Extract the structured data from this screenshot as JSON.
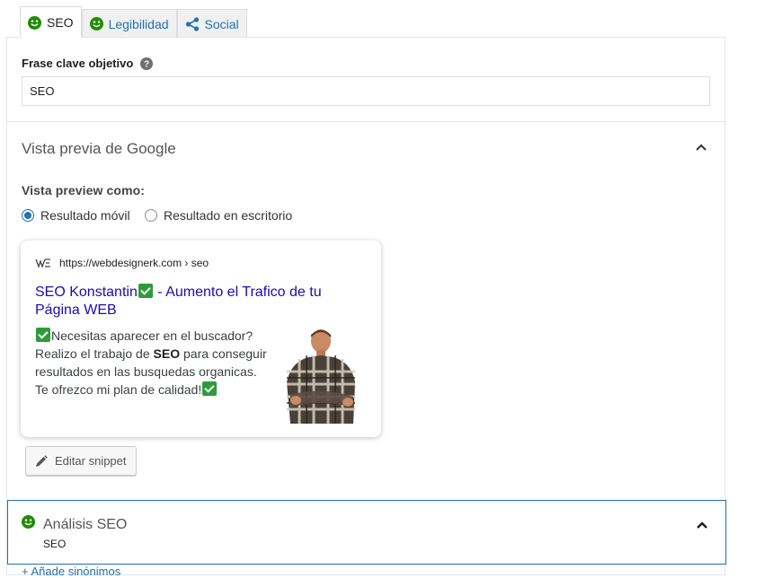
{
  "tabs": [
    {
      "label": "SEO",
      "icon": "smiley-good-icon",
      "active": true
    },
    {
      "label": "Legibilidad",
      "icon": "smiley-good-icon",
      "active": false
    },
    {
      "label": "Social",
      "icon": "share-icon",
      "active": false
    }
  ],
  "keyphrase": {
    "label": "Frase clave objetivo",
    "value": "SEO",
    "help_icon": "question-circle-icon"
  },
  "google_preview": {
    "title": "Vista previa de Google",
    "preview_label": "Vista preview como:",
    "options": [
      {
        "label": "Resultado móvil",
        "checked": true
      },
      {
        "label": "Resultado en escritorio",
        "checked": false
      }
    ],
    "snippet": {
      "url": "https://webdesignerk.com › seo",
      "title_part1": "SEO Konstantin",
      "title_part2": " - Aumento el Trafico de tu Página WEB",
      "desc_1": "Necesitas aparecer en el buscador? Realizo el trabajo de ",
      "desc_bold": "SEO",
      "desc_2": " para conseguir resultados en las busquedas organicas. Te ofrezco mi plan de calidad!"
    },
    "edit_label": "Editar snippet"
  },
  "analysis": {
    "title": "Análisis SEO",
    "subtitle": "SEO"
  },
  "synonyms_link": "+ Añade sinónimos",
  "colors": {
    "good": "#1e8c00",
    "link": "#2271b1",
    "serp_title": "#1a0dab",
    "check_green": "#2e9b3a"
  }
}
